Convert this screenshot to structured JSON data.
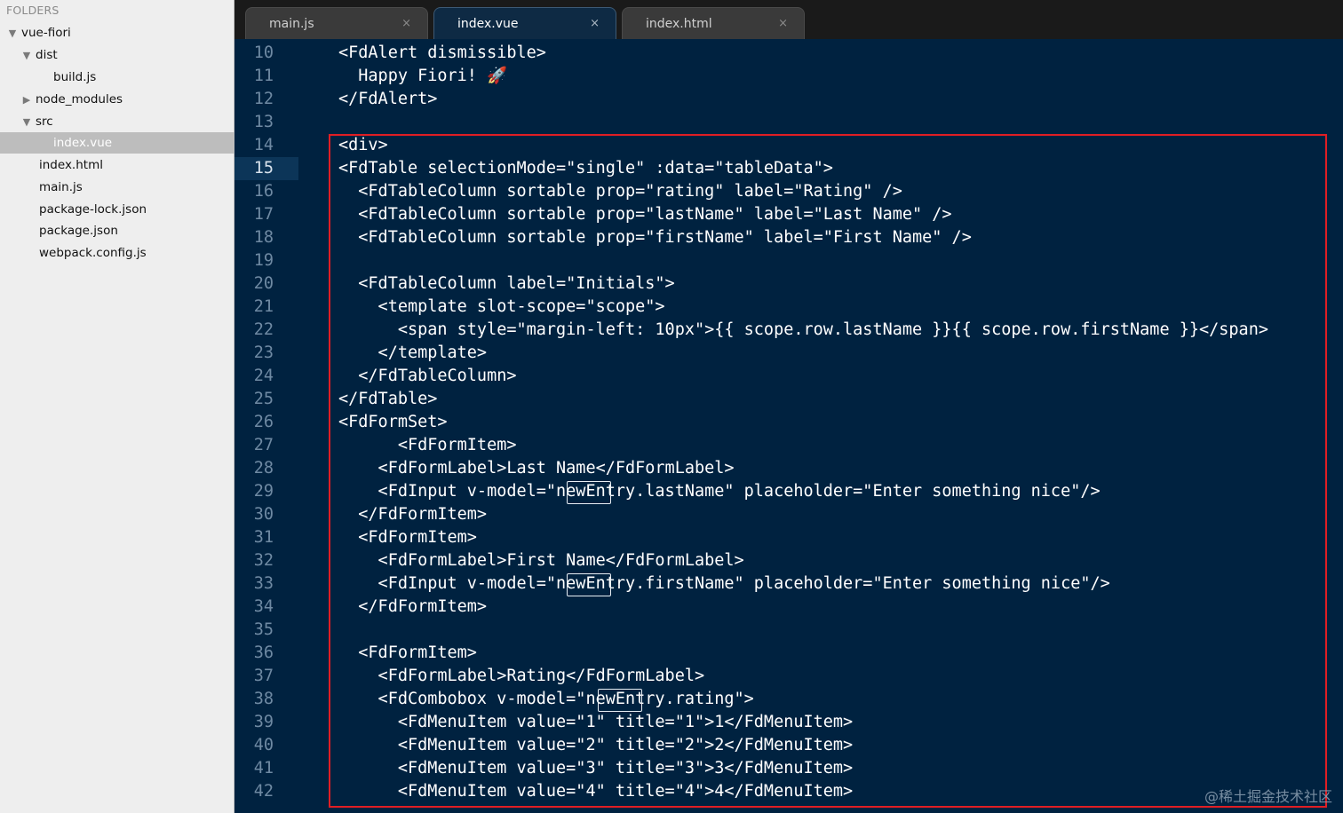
{
  "sidebar": {
    "title": "FOLDERS",
    "items": [
      {
        "label": "vue-fiori",
        "arrow": "▼"
      },
      {
        "label": "dist",
        "arrow": "▼"
      },
      {
        "label": "build.js",
        "arrow": ""
      },
      {
        "label": "node_modules",
        "arrow": "▶"
      },
      {
        "label": "src",
        "arrow": "▼"
      },
      {
        "label": "index.vue",
        "arrow": "",
        "selected": true
      },
      {
        "label": "index.html",
        "arrow": ""
      },
      {
        "label": "main.js",
        "arrow": ""
      },
      {
        "label": "package-lock.json",
        "arrow": ""
      },
      {
        "label": "package.json",
        "arrow": ""
      },
      {
        "label": "webpack.config.js",
        "arrow": ""
      }
    ]
  },
  "tabs": [
    {
      "label": "main.js",
      "close": "×",
      "active": false
    },
    {
      "label": "index.vue",
      "close": "×",
      "active": true
    },
    {
      "label": "index.html",
      "close": "×",
      "active": false
    }
  ],
  "editor": {
    "current_line": "15",
    "lines": [
      {
        "n": "10",
        "code": "<FdAlert dismissible>"
      },
      {
        "n": "11",
        "code": "  Happy Fiori! 🚀"
      },
      {
        "n": "12",
        "code": "</FdAlert>"
      },
      {
        "n": "13",
        "code": ""
      },
      {
        "n": "14",
        "code": "<div>"
      },
      {
        "n": "15",
        "code": "<FdTable selectionMode=\"single\" :data=\"tableData\">"
      },
      {
        "n": "16",
        "code": "  <FdTableColumn sortable prop=\"rating\" label=\"Rating\" />"
      },
      {
        "n": "17",
        "code": "  <FdTableColumn sortable prop=\"lastName\" label=\"Last Name\" />"
      },
      {
        "n": "18",
        "code": "  <FdTableColumn sortable prop=\"firstName\" label=\"First Name\" />"
      },
      {
        "n": "19",
        "code": ""
      },
      {
        "n": "20",
        "code": "  <FdTableColumn label=\"Initials\">"
      },
      {
        "n": "21",
        "code": "    <template slot-scope=\"scope\">"
      },
      {
        "n": "22",
        "code": "      <span style=\"margin-left: 10px\">{{ scope.row.lastName }}{{ scope.row.firstName }}</span>"
      },
      {
        "n": "23",
        "code": "    </template>"
      },
      {
        "n": "24",
        "code": "  </FdTableColumn>"
      },
      {
        "n": "25",
        "code": "</FdTable>"
      },
      {
        "n": "26",
        "code": "<FdFormSet>"
      },
      {
        "n": "27",
        "code": "      <FdFormItem>"
      },
      {
        "n": "28",
        "code": "    <FdFormLabel>Last Name</FdFormLabel>"
      },
      {
        "n": "29",
        "code": "    <FdInput v-model=\"newEntry.lastName\" placeholder=\"Enter something nice\"/>"
      },
      {
        "n": "30",
        "code": "  </FdFormItem>"
      },
      {
        "n": "31",
        "code": "  <FdFormItem>"
      },
      {
        "n": "32",
        "code": "    <FdFormLabel>First Name</FdFormLabel>"
      },
      {
        "n": "33",
        "code": "    <FdInput v-model=\"newEntry.firstName\" placeholder=\"Enter something nice\"/>"
      },
      {
        "n": "34",
        "code": "  </FdFormItem>"
      },
      {
        "n": "35",
        "code": ""
      },
      {
        "n": "36",
        "code": "  <FdFormItem>"
      },
      {
        "n": "37",
        "code": "    <FdFormLabel>Rating</FdFormLabel>"
      },
      {
        "n": "38",
        "code": "    <FdCombobox v-model=\"newEntry.rating\">"
      },
      {
        "n": "39",
        "code": "      <FdMenuItem value=\"1\" title=\"1\">1</FdMenuItem>"
      },
      {
        "n": "40",
        "code": "      <FdMenuItem value=\"2\" title=\"2\">2</FdMenuItem>"
      },
      {
        "n": "41",
        "code": "      <FdMenuItem value=\"3\" title=\"3\">3</FdMenuItem>"
      },
      {
        "n": "42",
        "code": "      <FdMenuItem value=\"4\" title=\"4\">4</FdMenuItem>"
      }
    ]
  },
  "watermark": "@稀土掘金技术社区",
  "colors": {
    "editor_bg": "#002240",
    "sidebar_bg": "#eeeeee",
    "highlight_border": "#e01e24",
    "tabbar_bg": "#1a1a1a"
  }
}
